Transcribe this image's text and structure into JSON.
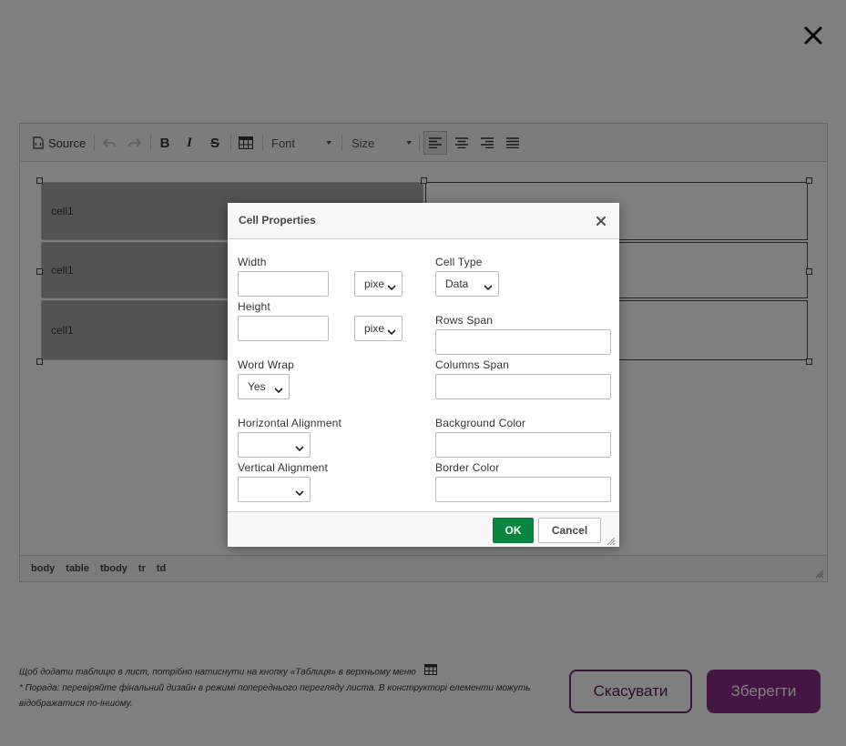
{
  "toolbar": {
    "source_label": "Source",
    "font_label": "Font",
    "size_label": "Size"
  },
  "table": {
    "cells": [
      "cell1",
      "cell1",
      "cell1"
    ]
  },
  "path": [
    "body",
    "table",
    "tbody",
    "tr",
    "td"
  ],
  "footer": {
    "hint_line1": "Щоб додати таблицю в лист, потрібно натиснути на кнопку «Таблиця» в верхньому меню",
    "hint_line2": "* Порада: перевіряйте фінальний дизайн в режимі попереднього перегляду листа. В конструкторі елементи можуть відображатися по-іншому.",
    "cancel_label": "Скасувати",
    "save_label": "Зберегти"
  },
  "dialog": {
    "title": "Cell Properties",
    "width_label": "Width",
    "width_value": "",
    "width_unit": "pixe",
    "height_label": "Height",
    "height_value": "",
    "height_unit": "pixe",
    "word_wrap_label": "Word Wrap",
    "word_wrap_value": "Yes",
    "h_align_label": "Horizontal Alignment",
    "h_align_value": "",
    "v_align_label": "Vertical Alignment",
    "v_align_value": "",
    "cell_type_label": "Cell Type",
    "cell_type_value": "Data",
    "rows_span_label": "Rows Span",
    "rows_span_value": "",
    "cols_span_label": "Columns Span",
    "cols_span_value": "",
    "bg_color_label": "Background Color",
    "bg_color_value": "",
    "border_color_label": "Border Color",
    "border_color_value": "",
    "ok_label": "OK",
    "cancel_label": "Cancel"
  },
  "colors": {
    "ok_green": "#09863e",
    "brand_purple": "#8b2c86",
    "overlay": "rgba(0,0,0,0.5)"
  }
}
